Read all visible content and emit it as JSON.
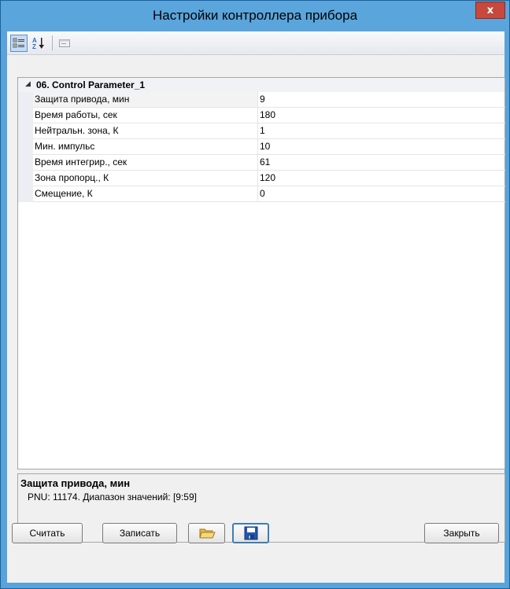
{
  "window": {
    "title": "Настройки контроллера прибора",
    "close_label": "x"
  },
  "toolbar": {
    "categorized_icon": "categorized-view-icon",
    "alphabetical_icon": "alphabetical-sort-icon",
    "property_pages_icon": "property-pages-icon"
  },
  "grid": {
    "group": {
      "expander": "◢",
      "label": "06. Control Parameter_1"
    },
    "rows": [
      {
        "name": "Защита привода, мин",
        "value": "9"
      },
      {
        "name": "Время работы, сек",
        "value": "180"
      },
      {
        "name": "Нейтральн. зона, К",
        "value": "1"
      },
      {
        "name": "Мин. импульс",
        "value": "10"
      },
      {
        "name": "Время интегрир., сек",
        "value": "61"
      },
      {
        "name": "Зона пропорц., К",
        "value": "120"
      },
      {
        "name": "Смещение, К",
        "value": "0"
      }
    ]
  },
  "description": {
    "title": "Защита привода, мин",
    "text": "PNU: 11174. Диапазон значений: [9:59]"
  },
  "buttons": {
    "read": "Считать",
    "write": "Записать",
    "open_icon": "folder-open-icon",
    "save_icon": "floppy-save-icon",
    "close": "Закрыть"
  }
}
